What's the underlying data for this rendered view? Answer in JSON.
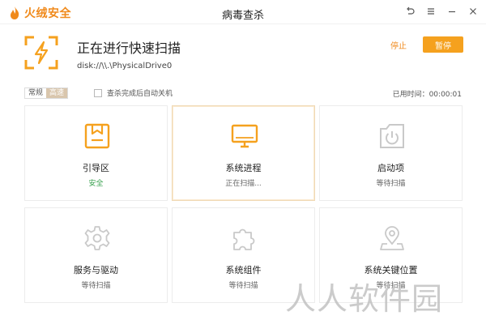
{
  "app": {
    "brand": "火绒安全",
    "window_title": "病毒查杀"
  },
  "window_controls": [
    {
      "name": "back-icon",
      "glyph": "⟲"
    },
    {
      "name": "menu-icon",
      "glyph": "≡"
    },
    {
      "name": "minimize-icon",
      "glyph": "—"
    },
    {
      "name": "close-icon",
      "glyph": "✕"
    }
  ],
  "scan": {
    "title": "正在进行快速扫描",
    "path": "disk://\\\\.\\PhysicalDrive0",
    "stop_label": "停止",
    "pause_label": "暂停"
  },
  "toolbar": {
    "modes": [
      "常规",
      "高速"
    ],
    "active_mode": "高速",
    "auto_shutdown_label": "查杀完成后自动关机",
    "elapsed": "已用时间：00:00:01"
  },
  "items": [
    {
      "name": "引导区",
      "status": "安全",
      "state": "safe",
      "icon": "boot-sector-icon"
    },
    {
      "name": "系统进程",
      "status": "正在扫描...",
      "state": "scanning",
      "icon": "monitor-icon"
    },
    {
      "name": "启动项",
      "status": "等待扫描",
      "state": "waiting",
      "icon": "power-icon"
    },
    {
      "name": "服务与驱动",
      "status": "等待扫描",
      "state": "waiting",
      "icon": "gear-icon"
    },
    {
      "name": "系统组件",
      "status": "等待扫描",
      "state": "waiting",
      "icon": "puzzle-icon"
    },
    {
      "name": "系统关键位置",
      "status": "等待扫描",
      "state": "waiting",
      "icon": "location-pin-icon"
    }
  ],
  "colors": {
    "accent": "#f5a11e",
    "brand": "#f08a1c",
    "safe": "#37a04d",
    "inactive_icon": "#c9c9c9"
  },
  "watermark": "人人软件园"
}
